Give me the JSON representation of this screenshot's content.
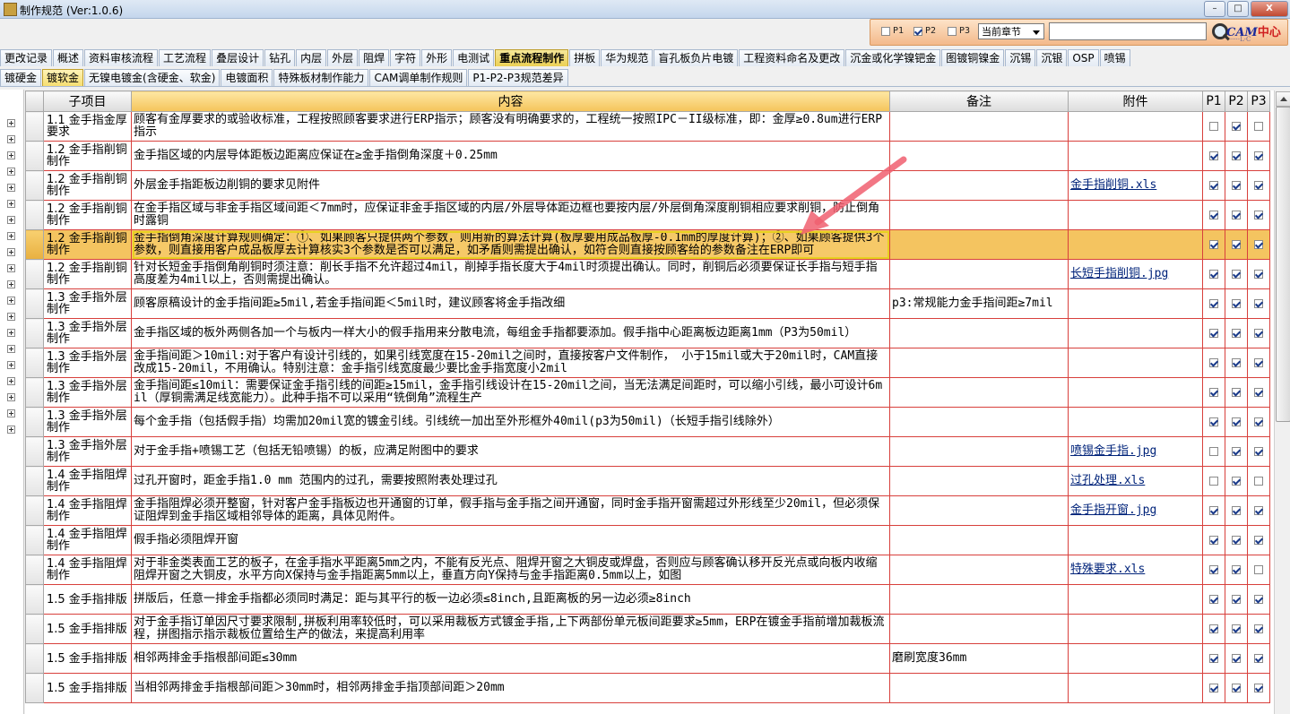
{
  "window": {
    "title": "制作规范 (Ver:1.0.6)",
    "minimize": "–",
    "maximize": "□",
    "close": "X"
  },
  "filters": {
    "p1": {
      "label": "P1",
      "checked": false
    },
    "p2": {
      "label": "P2",
      "checked": true
    },
    "p3": {
      "label": "P3",
      "checked": false
    },
    "chapter_select": "当前章节",
    "search_placeholder": ""
  },
  "logo": {
    "text": "CAM",
    "cn": "中心",
    "sub": "·····L·C"
  },
  "tabs_row1": [
    "更改记录",
    "概述",
    "资料审核流程",
    "工艺流程",
    "叠层设计",
    "钻孔",
    "内层",
    "外层",
    "阻焊",
    "字符",
    "外形",
    "电测试",
    "重点流程制作",
    "拼板",
    "华为规范",
    "盲孔板负片电镀",
    "工程资料命名及更改",
    "沉金或化学镍钯金",
    "图镀铜镍金",
    "沉锡",
    "沉银",
    "OSP",
    "喷锡"
  ],
  "tabs_row2": [
    "镀硬金",
    "镀软金",
    "无镍电镀金(含硬金、软金)",
    "电镀面积",
    "特殊板材制作能力",
    "CAM调单制作规则",
    "P1-P2-P3规范差异"
  ],
  "active_tab_row1": 12,
  "active_tab_row2": 1,
  "columns": {
    "sub": "子项目",
    "content": "内容",
    "note": "备注",
    "attach": "附件",
    "p1": "P1",
    "p2": "P2",
    "p3": "P3"
  },
  "rows": [
    {
      "sub": "1.1 金手指金厚要求",
      "content": "顾客有金厚要求的或验收标准，工程按照顾客要求进行ERP指示；顾客没有明确要求的，工程统一按照IPC－II级标准，即：金厚≥0.8um进行ERP指示",
      "note": "",
      "attach": "",
      "p1": false,
      "p2": true,
      "p3": false
    },
    {
      "sub": "1.2 金手指削铜制作",
      "content": "金手指区域的内层导体距板边距离应保证在≥金手指倒角深度＋0.25mm",
      "note": "",
      "attach": "",
      "p1": true,
      "p2": true,
      "p3": true
    },
    {
      "sub": "1.2 金手指削铜制作",
      "content": "外层金手指距板边削铜的要求见附件",
      "note": "",
      "attach": "金手指削铜.xls",
      "p1": true,
      "p2": true,
      "p3": true
    },
    {
      "sub": "1.2 金手指削铜制作",
      "content": "在金手指区域与非金手指区域间距＜7mm时，应保证非金手指区域的内层/外层导体距边框也要按内层/外层倒角深度削铜相应要求削铜，防止倒角时露铜",
      "note": "",
      "attach": "",
      "p1": true,
      "p2": true,
      "p3": true
    },
    {
      "sub": "1.2 金手指削铜制作",
      "content": "金手指倒角深度计算规则确定：①、如果顾客只提供两个参数，则用新的算法计算(板厚要用成品板厚-0.1mm的厚度计算)；②、如果顾客提供3个参数，则直接用客户成品板厚去计算核实3个参数是否可以满足，如矛盾则需提出确认，如符合则直接按顾客给的参数备注在ERP即可",
      "note": "",
      "attach": "",
      "p1": true,
      "p2": true,
      "p3": true,
      "highlight": true
    },
    {
      "sub": "1.2 金手指削铜制作",
      "content": "针对长短金手指倒角削铜时须注意：削长手指不允许超过4mil，削掉手指长度大于4mil时须提出确认。同时，削铜后必须要保证长手指与短手指高度差为4mil以上，否则需提出确认。",
      "note": "",
      "attach": "长短手指削铜.jpg",
      "p1": true,
      "p2": true,
      "p3": true
    },
    {
      "sub": "1.3 金手指外层制作",
      "content": "顾客原稿设计的金手指间距≥5mil,若金手指间距＜5mil时，建议顾客将金手指改细",
      "note": "p3:常规能力金手指间距≥7mil",
      "attach": "",
      "p1": true,
      "p2": true,
      "p3": true
    },
    {
      "sub": "1.3 金手指外层制作",
      "content": "金手指区域的板外两侧各加一个与板内一样大小的假手指用来分散电流，每组金手指都要添加。假手指中心距离板边距离1mm（P3为50mil）",
      "note": "",
      "attach": "",
      "p1": true,
      "p2": true,
      "p3": true
    },
    {
      "sub": "1.3 金手指外层制作",
      "content": "金手指间距＞10mil:对于客户有设计引线的，如果引线宽度在15-20mil之间时，直接按客户文件制作， 小于15mil或大于20mil时，CAM直接改成15-20mil，不用确认。特别注意：金手指引线宽度最少要比金手指宽度小2mil",
      "note": "",
      "attach": "",
      "p1": true,
      "p2": true,
      "p3": true
    },
    {
      "sub": "1.3 金手指外层制作",
      "content": "金手指间距≤10mil：需要保证金手指引线的间距≥15mil，金手指引线设计在15-20mil之间，当无法满足间距时，可以缩小引线，最小可设计6mil（厚铜需满足线宽能力）。此种手指不可以采用“铣倒角”流程生产",
      "note": "",
      "attach": "",
      "p1": true,
      "p2": true,
      "p3": true
    },
    {
      "sub": "1.3 金手指外层制作",
      "content": "每个金手指（包括假手指）均需加20mil宽的镀金引线。引线统一加出至外形框外40mil(p3为50mil)（长短手指引线除外）",
      "note": "",
      "attach": "",
      "p1": true,
      "p2": true,
      "p3": true
    },
    {
      "sub": "1.3 金手指外层制作",
      "content": "对于金手指+喷锡工艺（包括无铅喷锡）的板，应满足附图中的要求",
      "note": "",
      "attach": "喷锡金手指.jpg",
      "p1": false,
      "p2": true,
      "p3": true
    },
    {
      "sub": "1.4 金手指阻焊制作",
      "content": "过孔开窗时，距金手指1.0 mm 范围内的过孔，需要按照附表处理过孔",
      "note": "",
      "attach": "过孔处理.xls",
      "p1": false,
      "p2": true,
      "p3": false
    },
    {
      "sub": "1.4 金手指阻焊制作",
      "content": "金手指阻焊必须开整窗，针对客户金手指板边也开通窗的订单，假手指与金手指之间开通窗，同时金手指开窗需超过外形线至少20mil，但必须保证阻焊到金手指区域相邻导体的距离，具体见附件。",
      "note": "",
      "attach": "金手指开窗.jpg",
      "p1": true,
      "p2": true,
      "p3": true
    },
    {
      "sub": "1.4 金手指阻焊制作",
      "content": "假手指必须阻焊开窗",
      "note": "",
      "attach": "",
      "p1": true,
      "p2": true,
      "p3": true
    },
    {
      "sub": "1.4 金手指阻焊制作",
      "content": "对于非金类表面工艺的板子，在金手指水平距离5mm之内，不能有反光点、阻焊开窗之大铜皮或焊盘，否则应与顾客确认移开反光点或向板内收缩阻焊开窗之大铜皮，水平方向X保持与金手指距离5mm以上，垂直方向Y保持与金手指距离0.5mm以上，如图",
      "note": "",
      "attach": "特殊要求.xls",
      "p1": true,
      "p2": true,
      "p3": false
    },
    {
      "sub": "1.5 金手指排版",
      "content": "拼版后，任意一排金手指都必须同时满足：距与其平行的板一边必须≤8inch,且距离板的另一边必须≥8inch",
      "note": "",
      "attach": "",
      "p1": true,
      "p2": true,
      "p3": true
    },
    {
      "sub": "1.5 金手指排版",
      "content": "对于金手指订单因尺寸要求限制,拼板利用率较低时，可以采用裁板方式镀金手指,上下两部份单元板间距要求≥5mm，ERP在镀金手指前增加裁板流程，拼图指示指示裁板位置给生产的做法，来提高利用率",
      "note": "",
      "attach": "",
      "p1": true,
      "p2": true,
      "p3": true
    },
    {
      "sub": "1.5 金手指排版",
      "content": "相邻两排金手指根部间距≤30mm",
      "note": "磨刷宽度36mm",
      "attach": "",
      "p1": true,
      "p2": true,
      "p3": true
    },
    {
      "sub": "1.5 金手指排版",
      "content": "当相邻两排金手指根部间距＞30mm时，相邻两排金手指顶部间距＞20mm",
      "note": "",
      "attach": "",
      "p1": true,
      "p2": true,
      "p3": true
    }
  ],
  "colors": {
    "accent": "#f5c45a",
    "row_border": "#d8403c",
    "highlight": "#f4c460",
    "annotation_arrow": "#f06070"
  }
}
